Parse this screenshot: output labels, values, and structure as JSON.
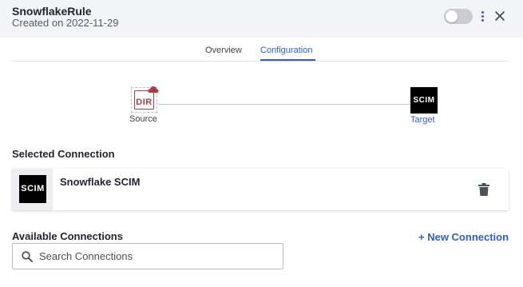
{
  "header": {
    "title": "SnowflakeRule",
    "subtitle": "Created on 2022-11-29",
    "toggle_on": false,
    "icons": [
      "more-vertical-icon",
      "close-icon"
    ]
  },
  "tabs": [
    {
      "label": "Overview",
      "active": false
    },
    {
      "label": "Configuration",
      "active": true
    }
  ],
  "flow": {
    "source": {
      "logo_text": "DIR",
      "label": "Source"
    },
    "target": {
      "logo_text": "SCIM",
      "label": "Target"
    }
  },
  "selected_connection": {
    "heading": "Selected Connection",
    "item": {
      "logo_text": "SCIM",
      "name": "Snowflake SCIM"
    }
  },
  "available_connections": {
    "heading": "Available Connections",
    "new_button": "+ New Connection",
    "search_placeholder": "Search Connections",
    "search_value": ""
  },
  "colors": {
    "accent": "#2f5bd3",
    "dir_red": "#b23a48",
    "header_bg": "#f3f4f8"
  }
}
